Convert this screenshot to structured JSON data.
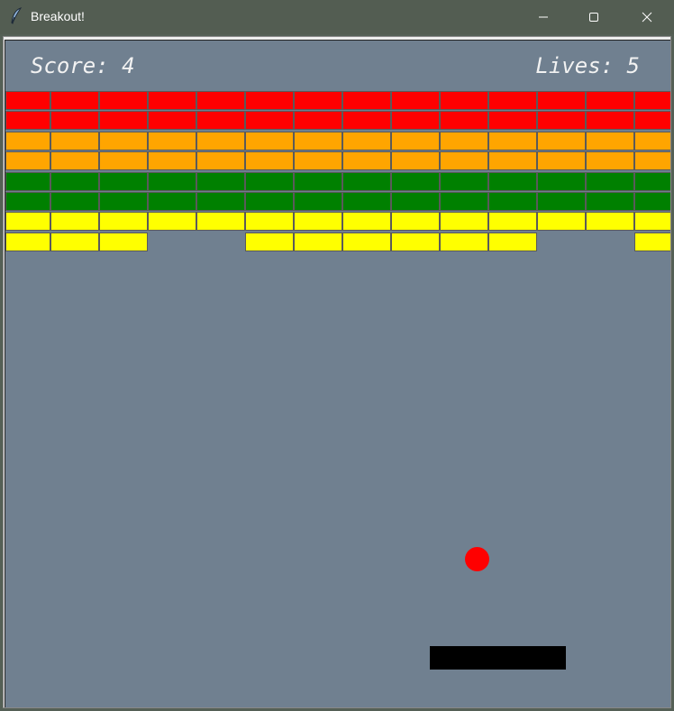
{
  "window": {
    "title": "Breakout!",
    "icon": "feather-icon"
  },
  "hud": {
    "score_text": "Score: 4",
    "lives_text": "Lives: 5"
  },
  "colors": {
    "background": "#708090",
    "row_colors": [
      "#ff0000",
      "#ff0000",
      "#ffa500",
      "#ffa500",
      "#008000",
      "#008000",
      "#ffff00",
      "#ffff00"
    ],
    "ball": "#ff0000",
    "paddle": "#000000"
  },
  "bricks": {
    "rows": 8,
    "columns": 14,
    "grid": [
      [
        1,
        1,
        1,
        1,
        1,
        1,
        1,
        1,
        1,
        1,
        1,
        1,
        1,
        1
      ],
      [
        1,
        1,
        1,
        1,
        1,
        1,
        1,
        1,
        1,
        1,
        1,
        1,
        1,
        1
      ],
      [
        1,
        1,
        1,
        1,
        1,
        1,
        1,
        1,
        1,
        1,
        1,
        1,
        1,
        1
      ],
      [
        1,
        1,
        1,
        1,
        1,
        1,
        1,
        1,
        1,
        1,
        1,
        1,
        1,
        1
      ],
      [
        1,
        1,
        1,
        1,
        1,
        1,
        1,
        1,
        1,
        1,
        1,
        1,
        1,
        1
      ],
      [
        1,
        1,
        1,
        1,
        1,
        1,
        1,
        1,
        1,
        1,
        1,
        1,
        1,
        1
      ],
      [
        1,
        1,
        1,
        1,
        1,
        1,
        1,
        1,
        1,
        1,
        1,
        1,
        1,
        1
      ],
      [
        1,
        1,
        1,
        0,
        0,
        1,
        1,
        1,
        1,
        1,
        1,
        0,
        0,
        1
      ]
    ]
  }
}
